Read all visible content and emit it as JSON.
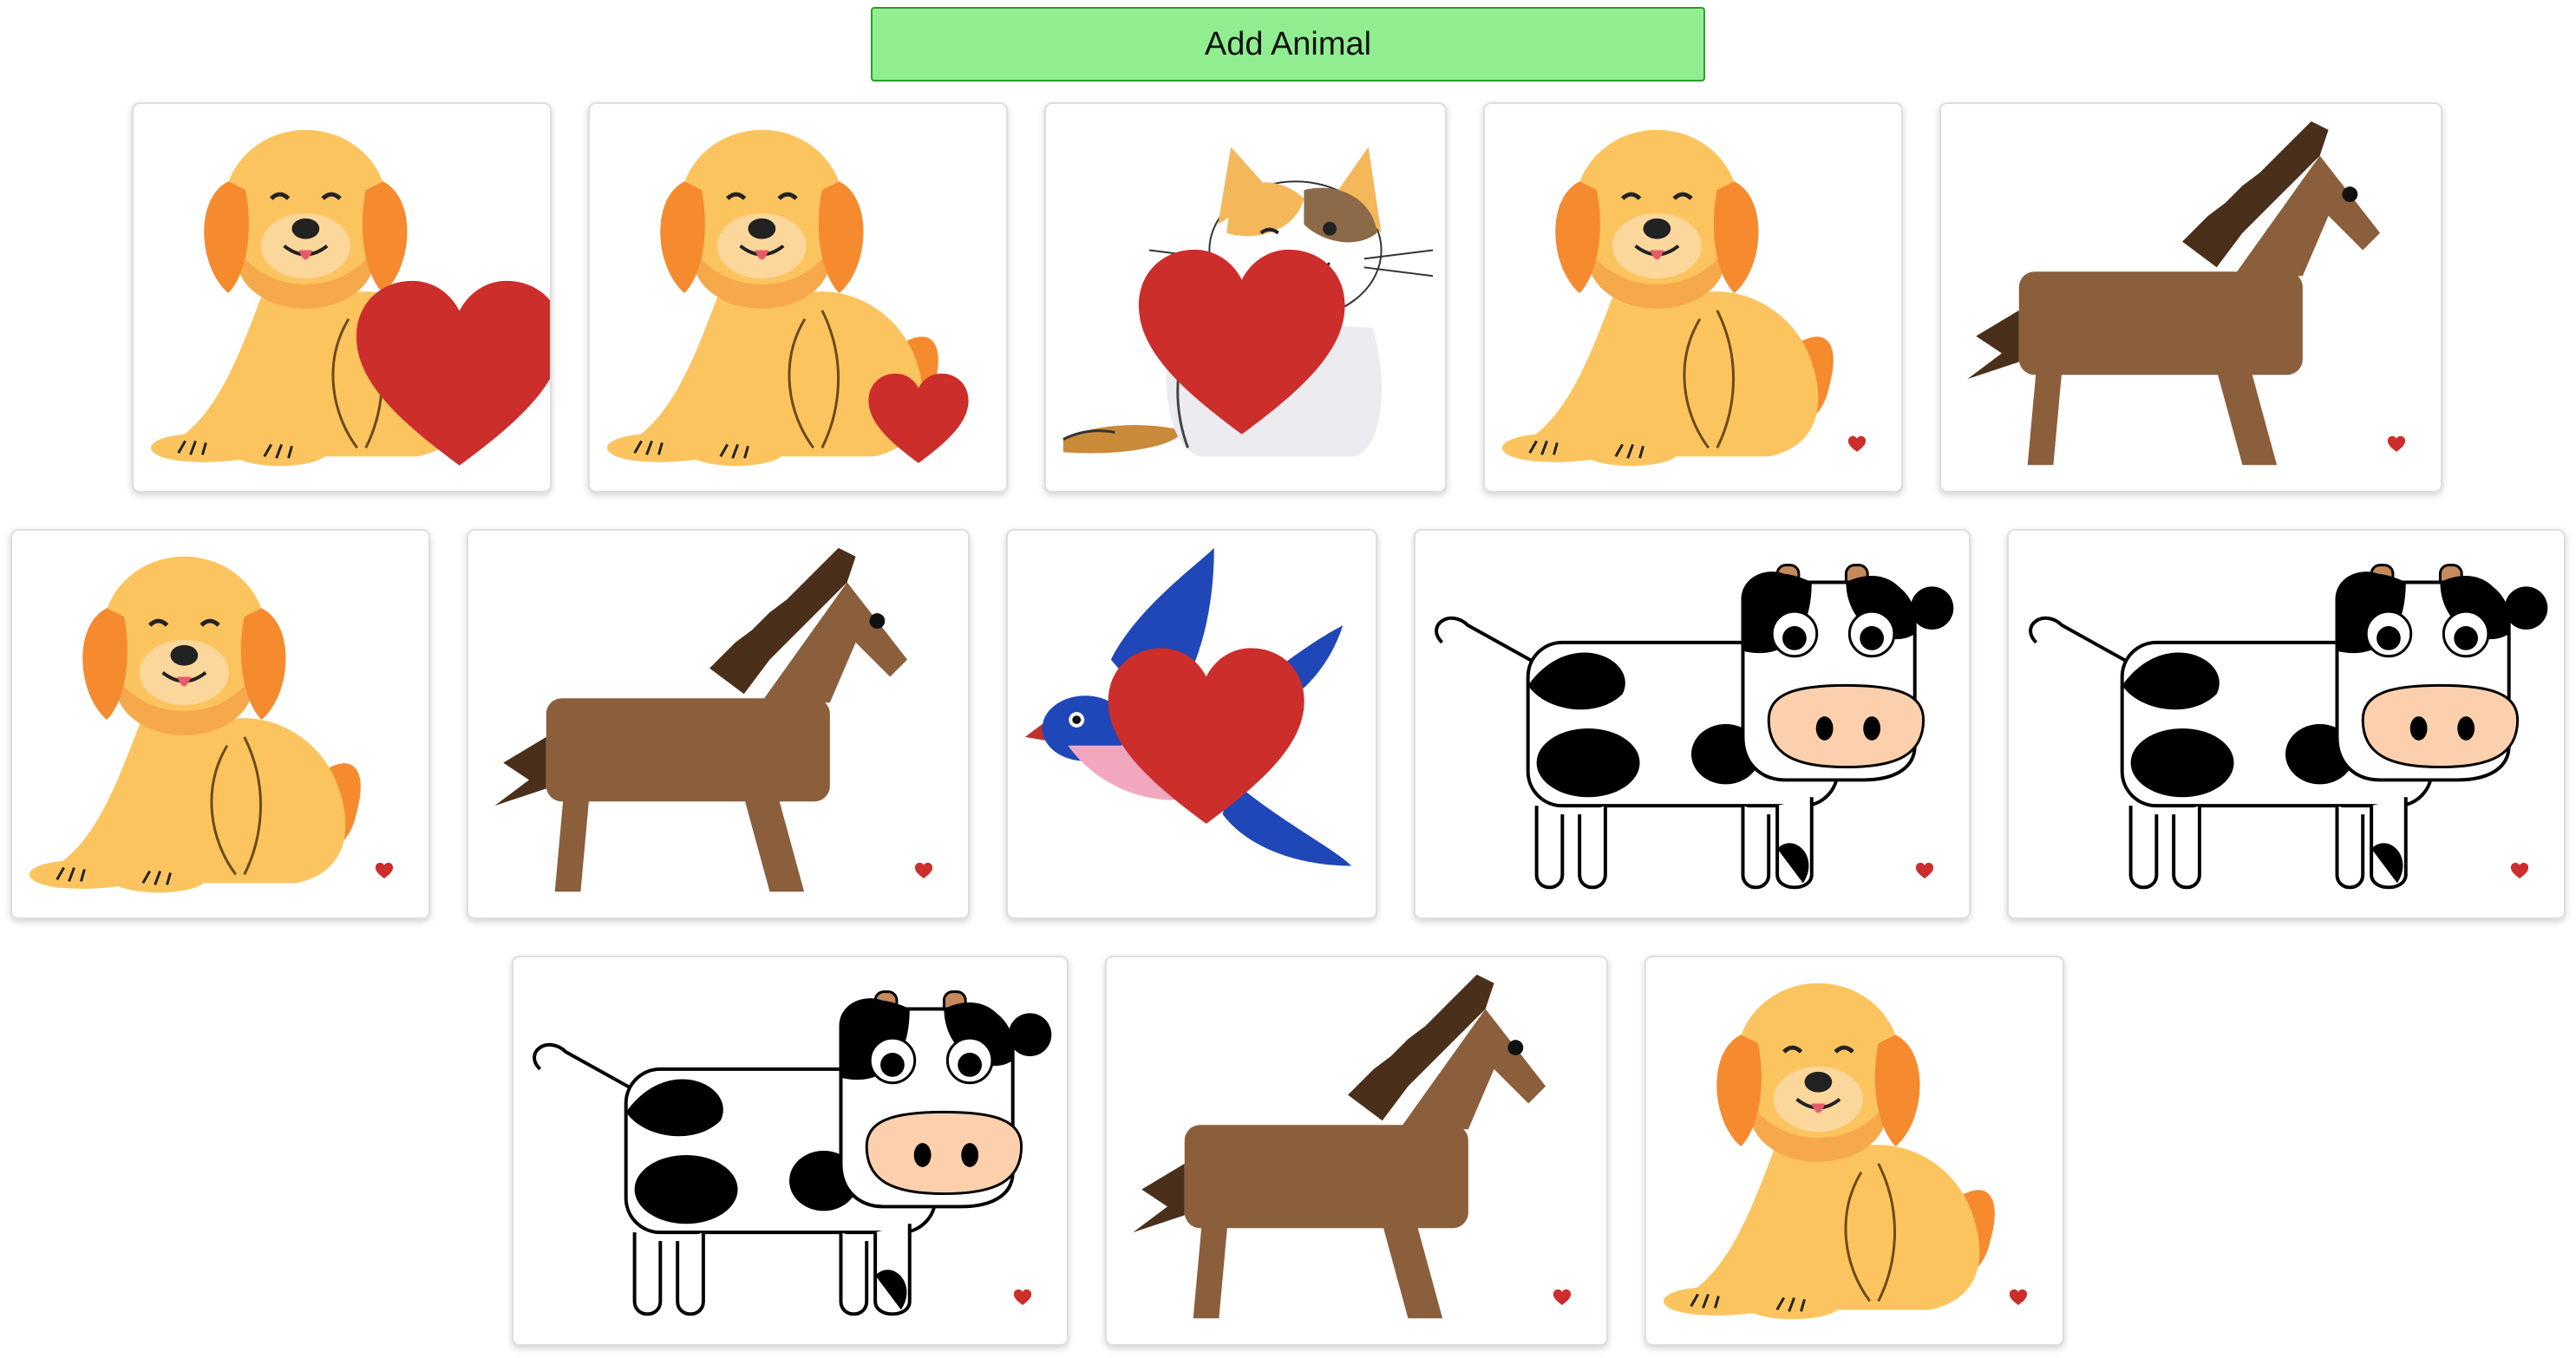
{
  "toolbar": {
    "add_label": "Add Animal"
  },
  "colors": {
    "button_bg": "#90ee90",
    "heart": "#cc2e2b",
    "dog_body": "#fcc45e",
    "dog_ears": "#f58a2f",
    "horse": "#8b5e3c",
    "horse_mane": "#4a2f1a",
    "bird_blue": "#1f47b8",
    "bird_pink": "#f2a7bf",
    "cow_spot": "#000000",
    "cow_nose": "#fcd0ad"
  },
  "animals": [
    {
      "type": "dog",
      "heart": "large"
    },
    {
      "type": "dog",
      "heart": "medium"
    },
    {
      "type": "cat",
      "heart": "large"
    },
    {
      "type": "dog",
      "heart": "small"
    },
    {
      "type": "horse",
      "heart": "small"
    },
    {
      "type": "dog",
      "heart": "small"
    },
    {
      "type": "horse",
      "heart": "small"
    },
    {
      "type": "bird",
      "heart": "large"
    },
    {
      "type": "cow",
      "heart": "small"
    },
    {
      "type": "cow",
      "heart": "small"
    },
    {
      "type": "cow",
      "heart": "small"
    },
    {
      "type": "horse",
      "heart": "small"
    },
    {
      "type": "dog",
      "heart": "small"
    }
  ]
}
